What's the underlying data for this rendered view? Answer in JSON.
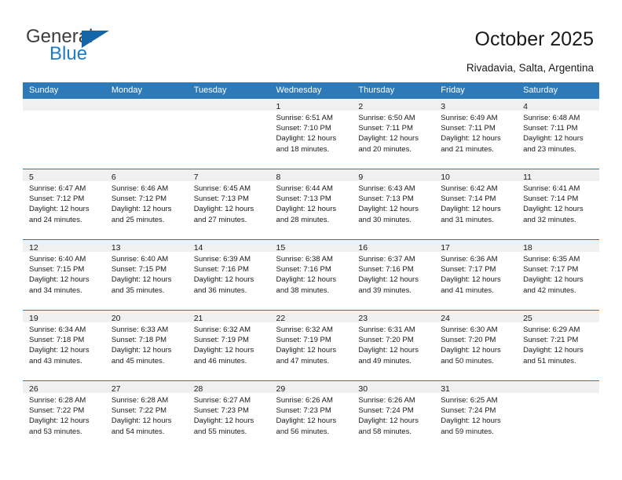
{
  "brand": {
    "name_top": "General",
    "name_bottom": "Blue",
    "flag_icon": "triangle-flag-icon",
    "color_top": "#3c3c3c",
    "color_bottom": "#1d7cc4",
    "flag_color": "#1565a8"
  },
  "header": {
    "title": "October 2025",
    "location": "Rivadavia, Salta, Argentina"
  },
  "theme": {
    "header_blue": "#2e7ab8",
    "day_band_gray": "#f0f0f0",
    "text": "#1a1a1a"
  },
  "weekdays": [
    "Sunday",
    "Monday",
    "Tuesday",
    "Wednesday",
    "Thursday",
    "Friday",
    "Saturday"
  ],
  "labels": {
    "sunrise": "Sunrise:",
    "sunset": "Sunset:",
    "daylight": "Daylight:"
  },
  "weeks": [
    [
      {
        "day": "",
        "empty": true
      },
      {
        "day": "",
        "empty": true
      },
      {
        "day": "",
        "empty": true
      },
      {
        "day": "1",
        "sunrise": "Sunrise: 6:51 AM",
        "sunset": "Sunset: 7:10 PM",
        "daylight1": "Daylight: 12 hours",
        "daylight2": "and 18 minutes."
      },
      {
        "day": "2",
        "sunrise": "Sunrise: 6:50 AM",
        "sunset": "Sunset: 7:11 PM",
        "daylight1": "Daylight: 12 hours",
        "daylight2": "and 20 minutes."
      },
      {
        "day": "3",
        "sunrise": "Sunrise: 6:49 AM",
        "sunset": "Sunset: 7:11 PM",
        "daylight1": "Daylight: 12 hours",
        "daylight2": "and 21 minutes."
      },
      {
        "day": "4",
        "sunrise": "Sunrise: 6:48 AM",
        "sunset": "Sunset: 7:11 PM",
        "daylight1": "Daylight: 12 hours",
        "daylight2": "and 23 minutes."
      }
    ],
    [
      {
        "day": "5",
        "sunrise": "Sunrise: 6:47 AM",
        "sunset": "Sunset: 7:12 PM",
        "daylight1": "Daylight: 12 hours",
        "daylight2": "and 24 minutes."
      },
      {
        "day": "6",
        "sunrise": "Sunrise: 6:46 AM",
        "sunset": "Sunset: 7:12 PM",
        "daylight1": "Daylight: 12 hours",
        "daylight2": "and 25 minutes."
      },
      {
        "day": "7",
        "sunrise": "Sunrise: 6:45 AM",
        "sunset": "Sunset: 7:13 PM",
        "daylight1": "Daylight: 12 hours",
        "daylight2": "and 27 minutes."
      },
      {
        "day": "8",
        "sunrise": "Sunrise: 6:44 AM",
        "sunset": "Sunset: 7:13 PM",
        "daylight1": "Daylight: 12 hours",
        "daylight2": "and 28 minutes."
      },
      {
        "day": "9",
        "sunrise": "Sunrise: 6:43 AM",
        "sunset": "Sunset: 7:13 PM",
        "daylight1": "Daylight: 12 hours",
        "daylight2": "and 30 minutes."
      },
      {
        "day": "10",
        "sunrise": "Sunrise: 6:42 AM",
        "sunset": "Sunset: 7:14 PM",
        "daylight1": "Daylight: 12 hours",
        "daylight2": "and 31 minutes."
      },
      {
        "day": "11",
        "sunrise": "Sunrise: 6:41 AM",
        "sunset": "Sunset: 7:14 PM",
        "daylight1": "Daylight: 12 hours",
        "daylight2": "and 32 minutes."
      }
    ],
    [
      {
        "day": "12",
        "sunrise": "Sunrise: 6:40 AM",
        "sunset": "Sunset: 7:15 PM",
        "daylight1": "Daylight: 12 hours",
        "daylight2": "and 34 minutes."
      },
      {
        "day": "13",
        "sunrise": "Sunrise: 6:40 AM",
        "sunset": "Sunset: 7:15 PM",
        "daylight1": "Daylight: 12 hours",
        "daylight2": "and 35 minutes."
      },
      {
        "day": "14",
        "sunrise": "Sunrise: 6:39 AM",
        "sunset": "Sunset: 7:16 PM",
        "daylight1": "Daylight: 12 hours",
        "daylight2": "and 36 minutes."
      },
      {
        "day": "15",
        "sunrise": "Sunrise: 6:38 AM",
        "sunset": "Sunset: 7:16 PM",
        "daylight1": "Daylight: 12 hours",
        "daylight2": "and 38 minutes."
      },
      {
        "day": "16",
        "sunrise": "Sunrise: 6:37 AM",
        "sunset": "Sunset: 7:16 PM",
        "daylight1": "Daylight: 12 hours",
        "daylight2": "and 39 minutes."
      },
      {
        "day": "17",
        "sunrise": "Sunrise: 6:36 AM",
        "sunset": "Sunset: 7:17 PM",
        "daylight1": "Daylight: 12 hours",
        "daylight2": "and 41 minutes."
      },
      {
        "day": "18",
        "sunrise": "Sunrise: 6:35 AM",
        "sunset": "Sunset: 7:17 PM",
        "daylight1": "Daylight: 12 hours",
        "daylight2": "and 42 minutes."
      }
    ],
    [
      {
        "day": "19",
        "sunrise": "Sunrise: 6:34 AM",
        "sunset": "Sunset: 7:18 PM",
        "daylight1": "Daylight: 12 hours",
        "daylight2": "and 43 minutes."
      },
      {
        "day": "20",
        "sunrise": "Sunrise: 6:33 AM",
        "sunset": "Sunset: 7:18 PM",
        "daylight1": "Daylight: 12 hours",
        "daylight2": "and 45 minutes."
      },
      {
        "day": "21",
        "sunrise": "Sunrise: 6:32 AM",
        "sunset": "Sunset: 7:19 PM",
        "daylight1": "Daylight: 12 hours",
        "daylight2": "and 46 minutes."
      },
      {
        "day": "22",
        "sunrise": "Sunrise: 6:32 AM",
        "sunset": "Sunset: 7:19 PM",
        "daylight1": "Daylight: 12 hours",
        "daylight2": "and 47 minutes."
      },
      {
        "day": "23",
        "sunrise": "Sunrise: 6:31 AM",
        "sunset": "Sunset: 7:20 PM",
        "daylight1": "Daylight: 12 hours",
        "daylight2": "and 49 minutes."
      },
      {
        "day": "24",
        "sunrise": "Sunrise: 6:30 AM",
        "sunset": "Sunset: 7:20 PM",
        "daylight1": "Daylight: 12 hours",
        "daylight2": "and 50 minutes."
      },
      {
        "day": "25",
        "sunrise": "Sunrise: 6:29 AM",
        "sunset": "Sunset: 7:21 PM",
        "daylight1": "Daylight: 12 hours",
        "daylight2": "and 51 minutes."
      }
    ],
    [
      {
        "day": "26",
        "sunrise": "Sunrise: 6:28 AM",
        "sunset": "Sunset: 7:22 PM",
        "daylight1": "Daylight: 12 hours",
        "daylight2": "and 53 minutes."
      },
      {
        "day": "27",
        "sunrise": "Sunrise: 6:28 AM",
        "sunset": "Sunset: 7:22 PM",
        "daylight1": "Daylight: 12 hours",
        "daylight2": "and 54 minutes."
      },
      {
        "day": "28",
        "sunrise": "Sunrise: 6:27 AM",
        "sunset": "Sunset: 7:23 PM",
        "daylight1": "Daylight: 12 hours",
        "daylight2": "and 55 minutes."
      },
      {
        "day": "29",
        "sunrise": "Sunrise: 6:26 AM",
        "sunset": "Sunset: 7:23 PM",
        "daylight1": "Daylight: 12 hours",
        "daylight2": "and 56 minutes."
      },
      {
        "day": "30",
        "sunrise": "Sunrise: 6:26 AM",
        "sunset": "Sunset: 7:24 PM",
        "daylight1": "Daylight: 12 hours",
        "daylight2": "and 58 minutes."
      },
      {
        "day": "31",
        "sunrise": "Sunrise: 6:25 AM",
        "sunset": "Sunset: 7:24 PM",
        "daylight1": "Daylight: 12 hours",
        "daylight2": "and 59 minutes."
      },
      {
        "day": "",
        "empty": true
      }
    ]
  ]
}
